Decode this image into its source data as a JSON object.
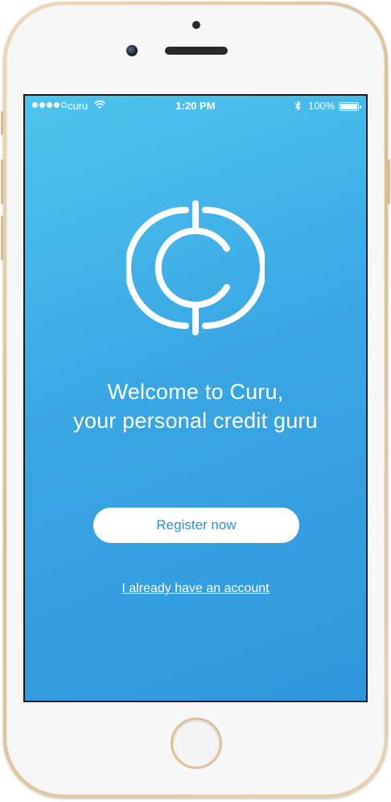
{
  "status_bar": {
    "carrier": "curu",
    "time": "1:20 PM",
    "battery": "100%"
  },
  "welcome": {
    "line1": "Welcome to Curu,",
    "line2": "your personal credit guru"
  },
  "actions": {
    "register_label": "Register now",
    "login_label": "I already have an account"
  },
  "icons": {
    "signal": "signal-dots-icon",
    "wifi": "wifi-icon",
    "bluetooth": "bluetooth-icon",
    "battery": "battery-icon",
    "logo": "curu-logo"
  },
  "colors": {
    "screen_gradient_start": "#4fc4ee",
    "screen_gradient_end": "#2e97db",
    "button_background": "#ffffff",
    "button_text": "#2a8fd6",
    "device_frame": "#d9bd93"
  }
}
